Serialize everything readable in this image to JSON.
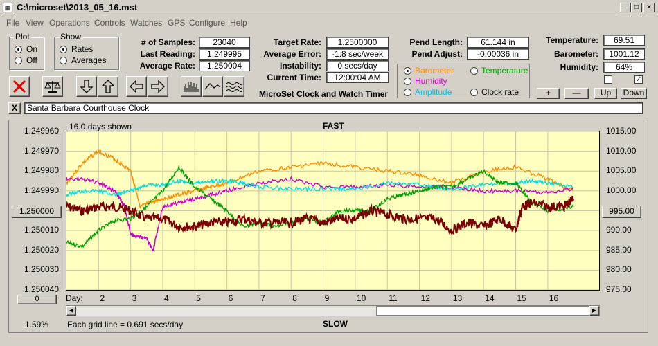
{
  "window": {
    "title": "C:\\microset\\2013_05_16.mst"
  },
  "menu": [
    "File",
    "View",
    "Operations",
    "Controls",
    "Watches",
    "GPS",
    "Configure",
    "Help"
  ],
  "plot_group": {
    "title": "Plot",
    "on": "On",
    "off": "Off",
    "selected": "On"
  },
  "show_group": {
    "title": "Show",
    "rates": "Rates",
    "averages": "Averages",
    "selected": "Rates"
  },
  "stats": {
    "samples_label": "# of Samples:",
    "samples": "23040",
    "last_label": "Last Reading:",
    "last": "1.249995",
    "avg_label": "Average Rate:",
    "avg": "1.250004"
  },
  "rates": {
    "target_label": "Target Rate:",
    "target": "1.2500000",
    "error_label": "Average Error:",
    "error": "-1.8 sec/week",
    "instab_label": "Instability:",
    "instab": "0 secs/day",
    "time_label": "Current Time:",
    "time": "12:00:04 AM",
    "product_title": "MicroSet Clock and Watch Timer"
  },
  "pend": {
    "length_label": "Pend Length:",
    "length": "61.144 in",
    "adjust_label": "Pend Adjust:",
    "adjust": "-0.00036 in"
  },
  "series_select": {
    "barometer": "Barometer",
    "temperature": "Temperature",
    "humidity": "Humidity",
    "amplitude": "Amplitude",
    "clockrate": "Clock rate",
    "selected": "Barometer"
  },
  "env": {
    "temp_label": "Temperature:",
    "temp": "69.51",
    "baro_label": "Barometer:",
    "baro": "1001.12",
    "hum_label": "Humidity:",
    "hum": "64%"
  },
  "controls": {
    "plus": "+",
    "minus": "—",
    "up": "Up",
    "down": "Down"
  },
  "clock_name": "Santa Barbara Courthouse Clock",
  "close_x": "X",
  "chart_header": {
    "days_shown": "16.0 days shown",
    "fast": "FAST",
    "slow": "SLOW",
    "grid_note": "Each grid line = 0.691 secs/day",
    "percent": "1.59%"
  },
  "axis_buttons": {
    "left": "1.250000",
    "right": "995.00",
    "bottom": "0"
  },
  "colors": {
    "temperature": "#ff8c00",
    "humidity": "#cc00cc",
    "amplitude": "#00e0e0",
    "barometer": "#00a000",
    "rate": "#7a0000",
    "plot_bg": "#ffffc0"
  },
  "chart_data": {
    "type": "line",
    "xlabel": "Day:",
    "x_ticks": [
      2,
      3,
      4,
      5,
      6,
      7,
      8,
      9,
      10,
      11,
      12,
      13,
      14,
      15,
      16
    ],
    "y_left_ticks": [
      "1.249960",
      "1.249970",
      "1.249980",
      "1.249990",
      "1.250000",
      "1.250010",
      "1.250020",
      "1.250030",
      "1.250040"
    ],
    "y_left_range": [
      1.24996,
      1.25004
    ],
    "y_right_ticks": [
      "1015.00",
      "1010.00",
      "1005.00",
      "1000.00",
      "995.00",
      "990.00",
      "985.00",
      "980.00",
      "975.00"
    ],
    "y_right_range": [
      975,
      1015
    ],
    "x_range": [
      1,
      17.6
    ],
    "series": [
      {
        "color": "#ff8c00",
        "x": [
          1,
          1.5,
          2,
          2.5,
          3,
          3.3,
          3.6,
          4,
          4.5,
          5,
          5.5,
          6,
          7,
          8,
          9,
          10,
          11,
          12,
          13,
          14,
          15,
          16,
          16.8
        ],
        "y": [
          1.249986,
          1.249976,
          1.24997,
          1.249974,
          1.24998,
          1.249998,
          1.249996,
          1.249994,
          1.249992,
          1.24999,
          1.249988,
          1.249986,
          1.24998,
          1.249978,
          1.249976,
          1.249978,
          1.24998,
          1.249982,
          1.249986,
          1.24998,
          1.249978,
          1.249984,
          1.24999
        ]
      },
      {
        "color": "#cc00cc",
        "x": [
          1,
          1.5,
          2,
          2.5,
          2.8,
          3,
          3.2,
          3.5,
          3.7,
          4,
          4.5,
          5,
          5.5,
          6,
          7,
          8,
          9,
          10,
          11,
          12,
          13,
          14,
          15,
          16,
          16.8
        ],
        "y": [
          1.249984,
          1.249984,
          1.249986,
          1.24999,
          1.249997,
          1.250012,
          1.250013,
          1.250014,
          1.25002,
          1.249998,
          1.249996,
          1.249994,
          1.249992,
          1.24999,
          1.249986,
          1.249984,
          1.249988,
          1.249988,
          1.249987,
          1.249988,
          1.249988,
          1.24999,
          1.24999,
          1.249991,
          1.249989
        ]
      },
      {
        "color": "#00e0e0",
        "x": [
          1,
          1.5,
          2,
          2.5,
          3,
          3.5,
          4,
          4.5,
          5,
          5.5,
          6,
          6.5,
          7,
          8,
          9,
          10,
          11,
          12,
          13,
          14,
          15,
          15.5,
          16,
          16.8
        ],
        "y": [
          1.249992,
          1.24999,
          1.24999,
          1.249992,
          1.24999,
          1.249987,
          1.249987,
          1.249985,
          1.249986,
          1.249985,
          1.249985,
          1.249986,
          1.249988,
          1.249989,
          1.249989,
          1.249989,
          1.249986,
          1.249987,
          1.249989,
          1.249987,
          1.249986,
          1.249985,
          1.249986,
          1.249988
        ]
      },
      {
        "color": "#00a000",
        "x": [
          1,
          1.5,
          2,
          2.5,
          3,
          3.5,
          4,
          4.5,
          5,
          5.5,
          6,
          6.5,
          7,
          7.5,
          8,
          8.5,
          9,
          9.5,
          10,
          10.5,
          11,
          11.5,
          12,
          12.5,
          13,
          13.5,
          14,
          14.5,
          15,
          15.5,
          16,
          16.8
        ],
        "y": [
          1.250016,
          1.250018,
          1.25001,
          1.250005,
          1.250004,
          1.249998,
          1.24999,
          1.249978,
          1.249988,
          1.249994,
          1.25,
          1.250008,
          1.250006,
          1.250008,
          1.250006,
          1.250004,
          1.250006,
          1.25,
          1.25,
          1.25,
          1.249994,
          1.249992,
          1.24999,
          1.249988,
          1.249988,
          1.249984,
          1.24998,
          1.249986,
          1.249986,
          1.249996,
          1.25,
          1.249998
        ]
      },
      {
        "color": "#7a0000",
        "x": [
          1,
          1.5,
          2,
          2.5,
          3,
          3.5,
          4,
          4.5,
          5,
          5.5,
          6,
          6.5,
          7,
          7.5,
          8,
          8.5,
          9,
          9.5,
          10,
          10.5,
          11,
          11.5,
          12,
          12.5,
          13,
          13.5,
          14,
          14.5,
          15,
          15.2,
          15.5,
          16,
          16.5,
          16.8
        ],
        "y": [
          1.249998,
          1.25,
          1.249998,
          1.249998,
          1.25,
          1.250004,
          1.250004,
          1.250008,
          1.250008,
          1.250006,
          1.250006,
          1.250004,
          1.250006,
          1.250006,
          1.250006,
          1.250004,
          1.250006,
          1.250004,
          1.250004,
          1.25,
          1.250002,
          1.250004,
          1.250004,
          1.250004,
          1.25001,
          1.250006,
          1.250008,
          1.250004,
          1.25001,
          1.249998,
          1.249996,
          1.249998,
          1.249998,
          1.249994
        ]
      }
    ]
  }
}
